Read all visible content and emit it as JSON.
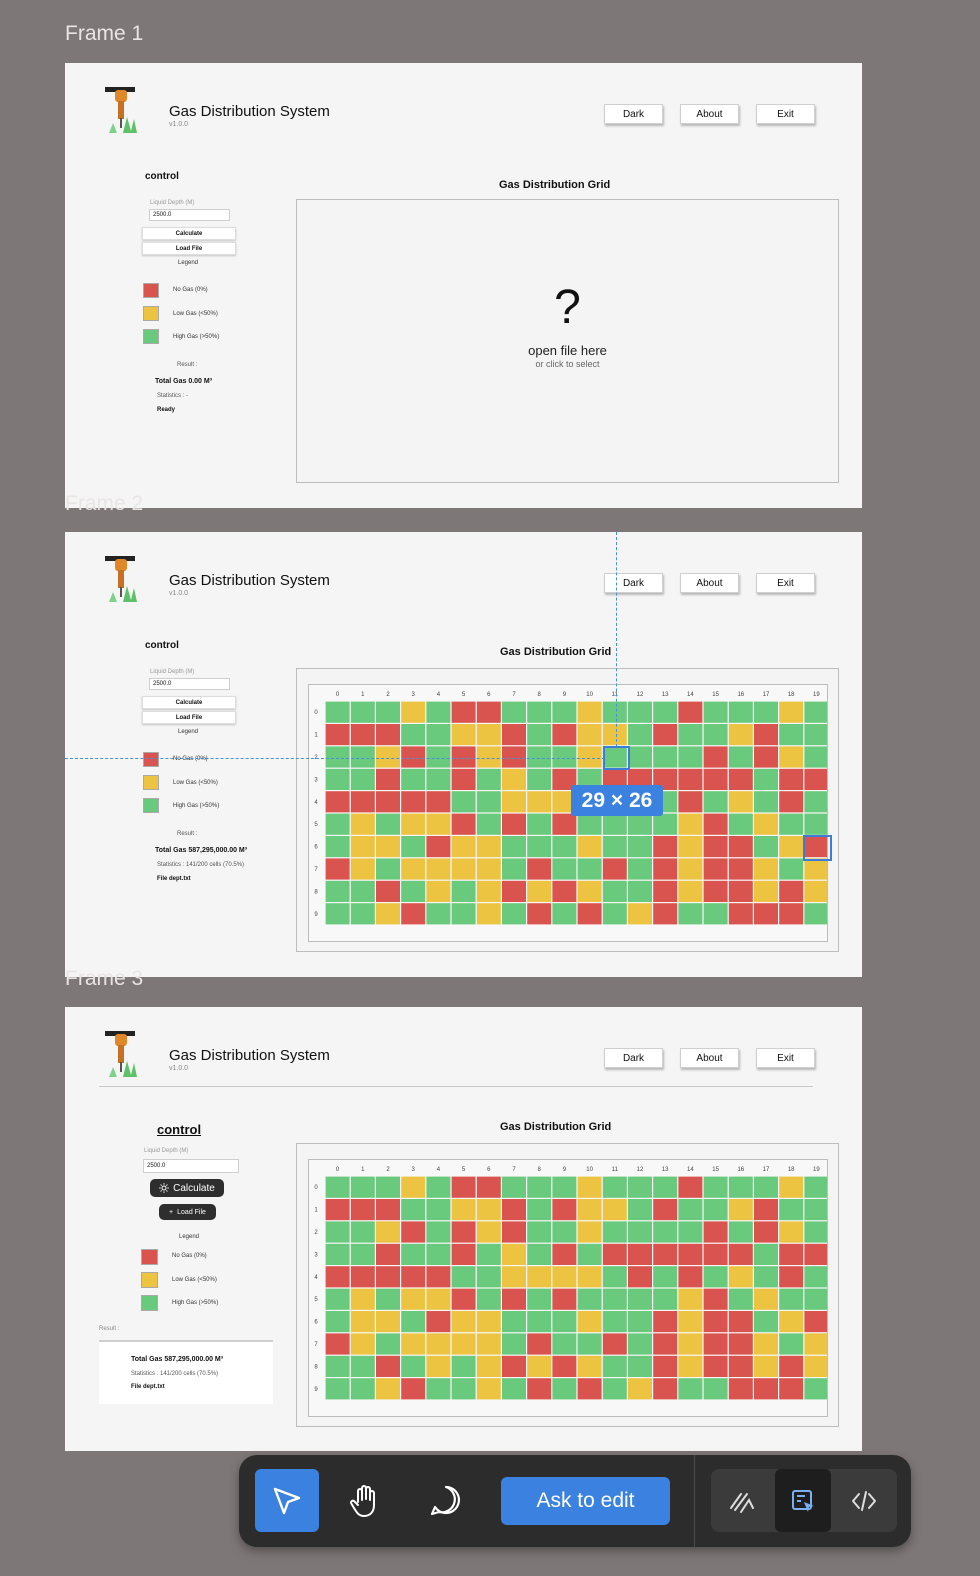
{
  "frames": [
    {
      "label": "Frame 1",
      "state": "empty",
      "result_total": "Total Gas 0.00 M³",
      "statistics": "Statistics : -",
      "status": "Ready"
    },
    {
      "label": "Frame 2",
      "state": "grid",
      "result_total": "Total Gas 587,295,000.00 M³",
      "statistics": "Statistics : 141/200 cells (70.5%)",
      "status": "File dept.txt"
    },
    {
      "label": "Frame 3",
      "state": "grid-styled",
      "result_total": "Total Gas 587,295,000.00 M³",
      "statistics": "Statistics : 141/200 cells (70.5%)",
      "status": "File dept.txt"
    }
  ],
  "app": {
    "title": "Gas Distribution System",
    "version": "v1.0.0"
  },
  "header_buttons": {
    "dark": "Dark",
    "about": "About",
    "exit": "Exit"
  },
  "control": {
    "title": "control",
    "depth_label": "Liquid Depth (M)",
    "depth_value": "2500.0",
    "calculate": "Calculate",
    "load_file": "Load File",
    "legend_title": "Legend",
    "result_label": "Result :"
  },
  "legend": [
    {
      "label": "No Gas (0%)",
      "color": "#d9534f"
    },
    {
      "label": "Low Gas (<50%)",
      "color": "#ecc441"
    },
    {
      "label": "High Gas (>50%)",
      "color": "#69c97c"
    }
  ],
  "grid": {
    "title": "Gas Distribution Grid",
    "empty_symbol": "?",
    "empty_text": "open file here",
    "empty_sub": "or click to select",
    "col_labels": [
      "0",
      "1",
      "2",
      "3",
      "4",
      "5",
      "6",
      "7",
      "8",
      "9",
      "10",
      "11",
      "12",
      "13",
      "14",
      "15",
      "16",
      "17",
      "18",
      "19"
    ],
    "row_labels": [
      "0",
      "1",
      "2",
      "3",
      "4",
      "5",
      "6",
      "7",
      "8",
      "9"
    ],
    "cells": [
      "GGGYGRRGGGYGGGRGGGYG",
      "RRRGGYYRGRYYGRGGYRGG",
      "GGYRGRYRGGYGGGGRGRYG",
      "GGRGGRGYGRGRRRRRRGRR",
      "RRRRRGGYYYYGRGRGYGRG",
      "GYGYYRGRGRGGGGYRGYGG",
      "GYYGRYYGGGYGGRYRRGYR",
      "RYGYYYYGRGGRGRYRRYGY",
      "GGRGYGYRYRYGGRYRRYRY",
      "GGYRGGYGRGRGYRGGRRRG"
    ]
  },
  "measure": {
    "label": "29 × 26"
  },
  "toolbar": {
    "ask_to_edit": "Ask to edit"
  },
  "icons": [
    "select-arrow-icon",
    "hand-icon",
    "comment-icon",
    "draw-icon",
    "inspect-icon",
    "code-icon",
    "sun-icon",
    "plus-icon"
  ],
  "accent": "#3b82e0"
}
